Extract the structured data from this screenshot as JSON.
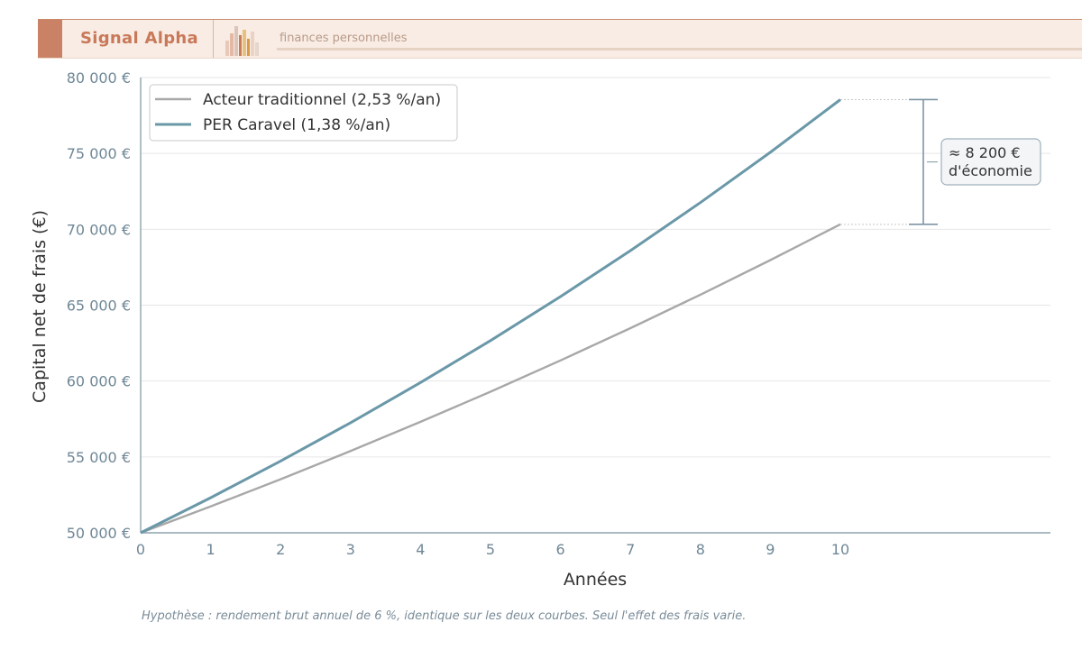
{
  "header": {
    "brand": "Signal Alpha",
    "tagline": "finances personnelles",
    "colors": {
      "brand": "#c9795a",
      "band": "#f8ece4"
    }
  },
  "chart_data": {
    "type": "line",
    "xlabel": "Années",
    "ylabel": "Capital net de frais (€)",
    "x": [
      0,
      1,
      2,
      3,
      4,
      5,
      6,
      7,
      8,
      9,
      10
    ],
    "xlim": [
      0,
      13
    ],
    "ylim": [
      50000,
      80000
    ],
    "yticks": [
      50000,
      55000,
      60000,
      65000,
      70000,
      75000,
      80000
    ],
    "ytick_labels": [
      "50 000 €",
      "55 000 €",
      "60 000 €",
      "65 000 €",
      "70 000 €",
      "75 000 €",
      "80 000 €"
    ],
    "xticks": [
      0,
      1,
      2,
      3,
      4,
      5,
      6,
      7,
      8,
      9,
      10
    ],
    "xtick_labels": [
      "0",
      "1",
      "2",
      "3",
      "4",
      "5",
      "6",
      "7",
      "8",
      "9",
      "10"
    ],
    "grid": "horizontal",
    "legend_position": "top-left",
    "series": [
      {
        "name": "Acteur traditionnel (2,53 %/an)",
        "color": "#a8a8a8",
        "values": [
          50000,
          51735,
          53530,
          55388,
          57310,
          59299,
          61357,
          63486,
          65689,
          67968,
          70327
        ]
      },
      {
        "name": "PER Caravel (1,38 %/an)",
        "color": "#6a98a8",
        "values": [
          50000,
          52310,
          54727,
          57255,
          59901,
          62668,
          65564,
          68593,
          71762,
          75077,
          78546
        ]
      }
    ],
    "annotation": {
      "line1": "≈ 8 200 €",
      "line2": "d'économie",
      "from": 70327,
      "to": 78546
    }
  },
  "footnote": "Hypothèse : rendement brut annuel de 6 %, identique sur les deux courbes. Seul l'effet des frais varie."
}
